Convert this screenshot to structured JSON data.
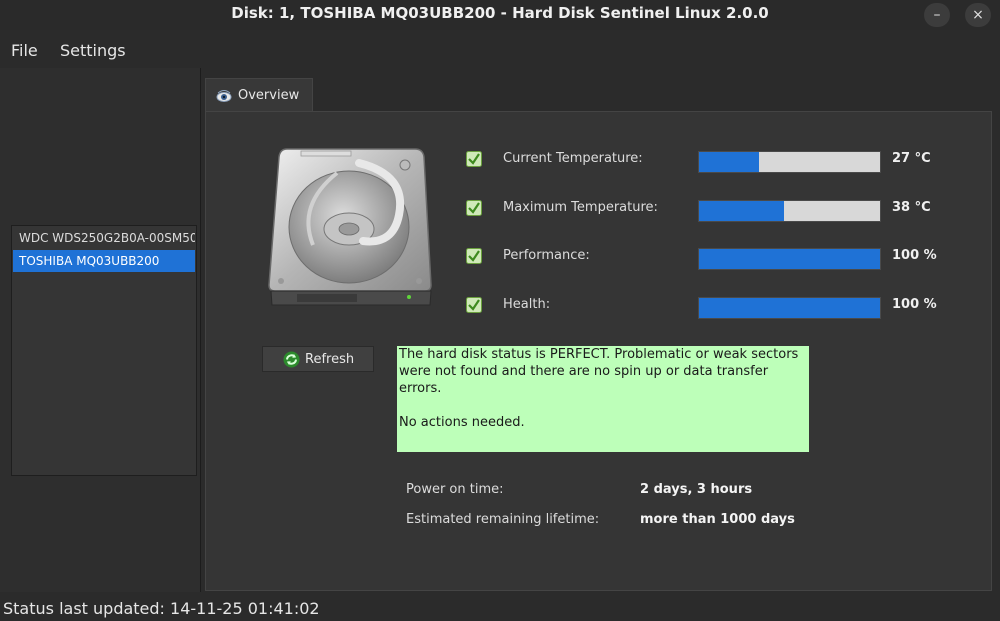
{
  "window": {
    "title": "Disk: 1, TOSHIBA MQ03UBB200 - Hard Disk Sentinel Linux 2.0.0",
    "minimize_glyph": "–",
    "close_glyph": "×"
  },
  "menu": [
    "File",
    "Settings"
  ],
  "disks": [
    {
      "label": "WDC  WDS250G2B0A-00SM50",
      "selected": false
    },
    {
      "label": "TOSHIBA MQ03UBB200",
      "selected": true
    }
  ],
  "tabs": [
    {
      "label": "Overview",
      "icon": "eye-icon"
    }
  ],
  "metrics": [
    {
      "label": "Current Temperature:",
      "value": "27 °C",
      "fill": 0.33
    },
    {
      "label": "Maximum Temperature:",
      "value": "38 °C",
      "fill": 0.47
    },
    {
      "label": "Performance:",
      "value": "100 %",
      "fill": 1.0
    },
    {
      "label": "Health:",
      "value": "100 %",
      "fill": 1.0
    }
  ],
  "refresh_label": "Refresh",
  "status_message": {
    "line1": "The hard disk status is PERFECT. Problematic or weak sectors were not found and there are no spin up or data transfer errors.",
    "line2": "No actions needed."
  },
  "info": [
    {
      "label": "Power on time:",
      "value": "2 days, 3 hours"
    },
    {
      "label": "Estimated remaining lifetime:",
      "value": "more than 1000 days"
    }
  ],
  "statusbar": "Status last updated: 14-11-25 01:41:02",
  "colors": {
    "accent": "#1f72d6",
    "status_bg": "#bdffb9",
    "check_green": "#7bc043"
  }
}
